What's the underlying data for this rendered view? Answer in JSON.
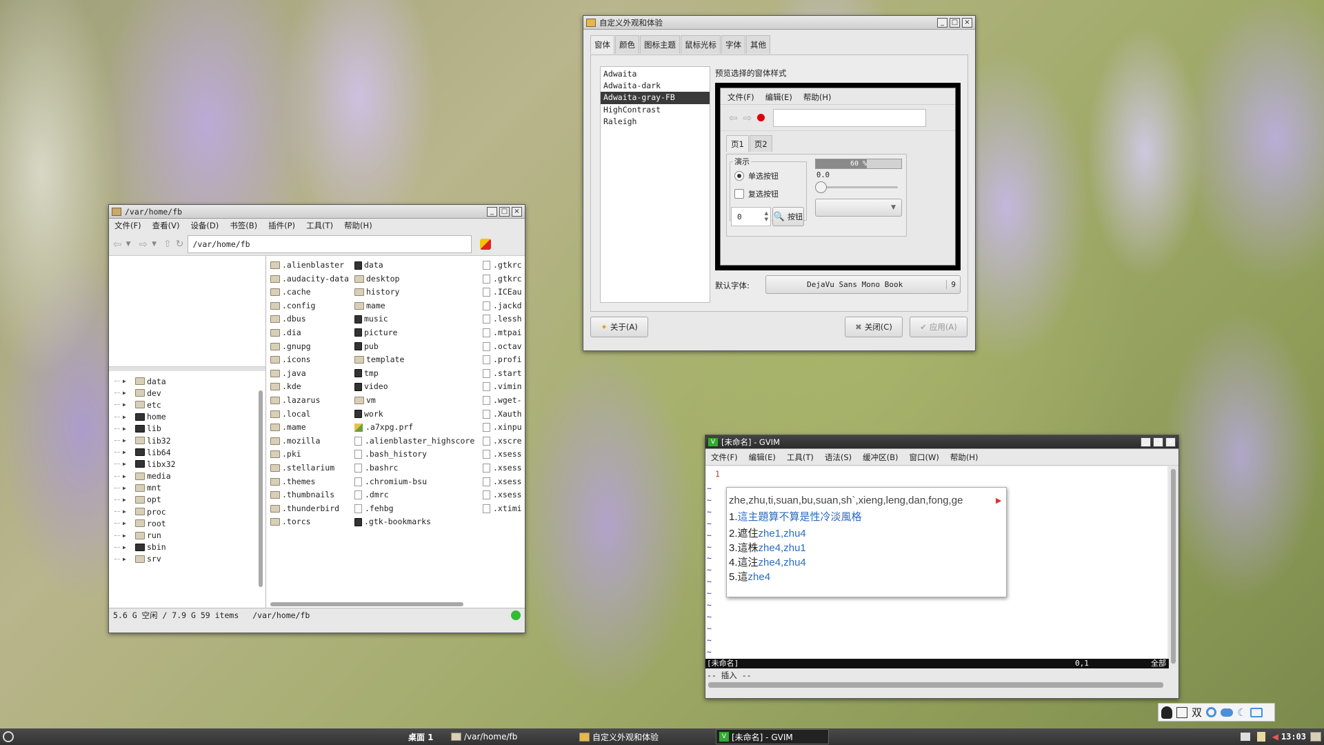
{
  "fm": {
    "title": "/var/home/fb",
    "menu": [
      "文件(F)",
      "查看(V)",
      "设备(D)",
      "书签(B)",
      "插件(P)",
      "工具(T)",
      "帮助(H)"
    ],
    "path": "/var/home/fb",
    "tree": [
      {
        "name": "data",
        "lnk": false
      },
      {
        "name": "dev",
        "lnk": false
      },
      {
        "name": "etc",
        "lnk": false
      },
      {
        "name": "home",
        "lnk": true
      },
      {
        "name": "lib",
        "lnk": true
      },
      {
        "name": "lib32",
        "lnk": false
      },
      {
        "name": "lib64",
        "lnk": true
      },
      {
        "name": "libx32",
        "lnk": true
      },
      {
        "name": "media",
        "lnk": false
      },
      {
        "name": "mnt",
        "lnk": false
      },
      {
        "name": "opt",
        "lnk": false
      },
      {
        "name": "proc",
        "lnk": false
      },
      {
        "name": "root",
        "lnk": false
      },
      {
        "name": "run",
        "lnk": false
      },
      {
        "name": "sbin",
        "lnk": true
      },
      {
        "name": "srv",
        "lnk": false
      }
    ],
    "col1": [
      ".alienblaster",
      ".audacity-data",
      ".cache",
      ".config",
      ".dbus",
      ".dia",
      ".gnupg",
      ".icons",
      ".java",
      ".kde",
      ".lazarus",
      ".local",
      ".mame",
      ".mozilla",
      ".pki",
      ".stellarium",
      ".themes",
      ".thumbnails",
      ".thunderbird",
      ".torcs"
    ],
    "col2": [
      {
        "name": "data",
        "t": "lnk"
      },
      {
        "name": "desktop",
        "t": "dir"
      },
      {
        "name": "history",
        "t": "dir"
      },
      {
        "name": "mame",
        "t": "dir"
      },
      {
        "name": "music",
        "t": "lnk"
      },
      {
        "name": "picture",
        "t": "lnk"
      },
      {
        "name": "pub",
        "t": "lnk"
      },
      {
        "name": "template",
        "t": "dir"
      },
      {
        "name": "tmp",
        "t": "lnk"
      },
      {
        "name": "video",
        "t": "lnk"
      },
      {
        "name": "vm",
        "t": "dir"
      },
      {
        "name": "work",
        "t": "lnk"
      },
      {
        "name": ".a7xpg.prf",
        "t": "img"
      },
      {
        "name": ".alienblaster_highscore",
        "t": "file"
      },
      {
        "name": ".bash_history",
        "t": "file"
      },
      {
        "name": ".bashrc",
        "t": "file"
      },
      {
        "name": ".chromium-bsu",
        "t": "file"
      },
      {
        "name": ".dmrc",
        "t": "file"
      },
      {
        "name": ".fehbg",
        "t": "file"
      },
      {
        "name": ".gtk-bookmarks",
        "t": "lnk"
      }
    ],
    "col3": [
      ".gtkrc",
      ".gtkrc",
      ".ICEau",
      ".jackd",
      ".lessh",
      ".mtpai",
      ".octav",
      ".profi",
      ".start",
      ".vimin",
      ".wget-",
      ".Xauth",
      ".xinpu",
      ".xscre",
      ".xsess",
      ".xsess",
      ".xsess",
      ".xsess",
      ".xtimi"
    ],
    "status": {
      "space": "5.6 G 空闲 / 7.9 G 59 items",
      "path": "/var/home/fb"
    }
  },
  "ap": {
    "title": "自定义外观和体验",
    "tabs": [
      "窗体",
      "颜色",
      "图标主题",
      "鼠标光标",
      "字体",
      "其他"
    ],
    "themes": [
      "Adwaita",
      "Adwaita-dark",
      "Adwaita-gray-FB",
      "HighContrast",
      "Raleigh"
    ],
    "selected_theme": "Adwaita-gray-FB",
    "preview_label": "预览选择的窗体样式",
    "pv": {
      "menu": [
        "文件(F)",
        "编辑(E)",
        "帮助(H)"
      ],
      "tabs": [
        "页1",
        "页2"
      ],
      "frame": "演示",
      "radio": "单选按钮",
      "check": "复选按钮",
      "spin": "0",
      "btn": "按钮",
      "progress": "60 %",
      "progress_value": 0.6,
      "scale": "0.0"
    },
    "font_label": "默认字体:",
    "font": "DejaVu Sans Mono Book",
    "font_size": "9",
    "about": "关于(A)",
    "close": "关闭(C)",
    "apply": "应用(A)"
  },
  "vim": {
    "title": "[未命名] - GVIM",
    "menu": [
      "文件(F)",
      "编辑(E)",
      "工具(T)",
      "语法(S)",
      "缓冲区(B)",
      "窗口(W)",
      "帮助(H)"
    ],
    "linenum": "1",
    "ime": {
      "preedit": "zhe,zhu,ti,suan,bu,suan,sh`,xieng,leng,dan,fong,ge",
      "c1": "1.",
      "c1t": "這主題算不算是性冷淡風格",
      "cands": [
        {
          "n": "2.",
          "h": "遮住",
          "p": "zhe1,zhu4"
        },
        {
          "n": "3.",
          "h": "這株",
          "p": "zhe4,zhu1"
        },
        {
          "n": "4.",
          "h": "這注",
          "p": "zhe4,zhu4"
        },
        {
          "n": "5.",
          "h": "這",
          "p": "zhe4"
        }
      ]
    },
    "status": {
      "name": "[未命名]",
      "pos": "0,1",
      "all": "全部"
    },
    "mode": "-- 插入 --"
  },
  "taskbar": {
    "desktop": "桌面 1",
    "tasks": [
      "/var/home/fb",
      "自定义外观和体验",
      "[未命名] - GVIM"
    ],
    "clock": "13:03",
    "ime_char": "双"
  }
}
